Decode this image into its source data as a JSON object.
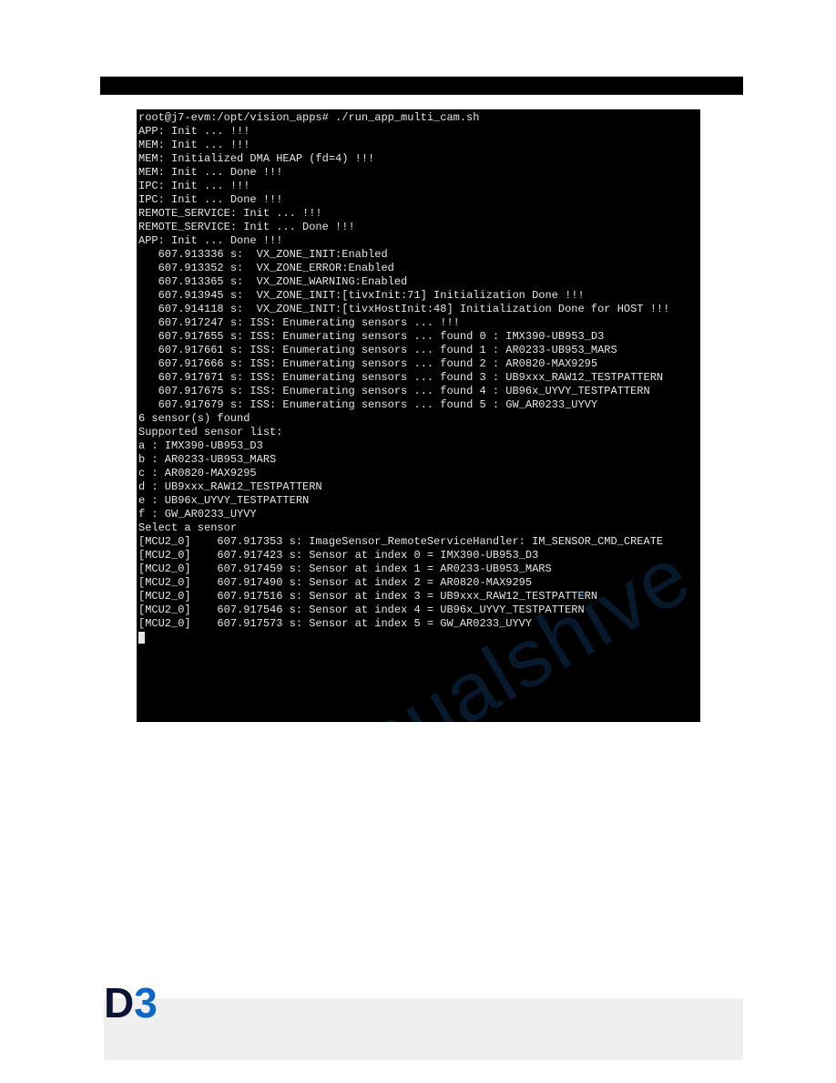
{
  "watermark_text": "manualshive.com",
  "logo": {
    "d": "D",
    "three": "3"
  },
  "terminal": {
    "lines": [
      "root@j7-evm:/opt/vision_apps# ./run_app_multi_cam.sh",
      "APP: Init ... !!!",
      "MEM: Init ... !!!",
      "MEM: Initialized DMA HEAP (fd=4) !!!",
      "MEM: Init ... Done !!!",
      "IPC: Init ... !!!",
      "IPC: Init ... Done !!!",
      "REMOTE_SERVICE: Init ... !!!",
      "REMOTE_SERVICE: Init ... Done !!!",
      "APP: Init ... Done !!!",
      "   607.913336 s:  VX_ZONE_INIT:Enabled",
      "   607.913352 s:  VX_ZONE_ERROR:Enabled",
      "   607.913365 s:  VX_ZONE_WARNING:Enabled",
      "   607.913945 s:  VX_ZONE_INIT:[tivxInit:71] Initialization Done !!!",
      "   607.914118 s:  VX_ZONE_INIT:[tivxHostInit:48] Initialization Done for HOST !!!",
      "   607.917247 s: ISS: Enumerating sensors ... !!!",
      "   607.917655 s: ISS: Enumerating sensors ... found 0 : IMX390-UB953_D3",
      "   607.917661 s: ISS: Enumerating sensors ... found 1 : AR0233-UB953_MARS",
      "   607.917666 s: ISS: Enumerating sensors ... found 2 : AR0820-MAX9295",
      "   607.917671 s: ISS: Enumerating sensors ... found 3 : UB9xxx_RAW12_TESTPATTERN",
      "   607.917675 s: ISS: Enumerating sensors ... found 4 : UB96x_UYVY_TESTPATTERN",
      "   607.917679 s: ISS: Enumerating sensors ... found 5 : GW_AR0233_UYVY",
      "6 sensor(s) found",
      "Supported sensor list:",
      "a : IMX390-UB953_D3",
      "b : AR0233-UB953_MARS",
      "c : AR0820-MAX9295",
      "d : UB9xxx_RAW12_TESTPATTERN",
      "e : UB96x_UYVY_TESTPATTERN",
      "f : GW_AR0233_UYVY",
      "Select a sensor",
      "[MCU2_0]    607.917353 s: ImageSensor_RemoteServiceHandler: IM_SENSOR_CMD_CREATE",
      "[MCU2_0]    607.917423 s: Sensor at index 0 = IMX390-UB953_D3",
      "[MCU2_0]    607.917459 s: Sensor at index 1 = AR0233-UB953_MARS",
      "[MCU2_0]    607.917490 s: Sensor at index 2 = AR0820-MAX9295",
      "[MCU2_0]    607.917516 s: Sensor at index 3 = UB9xxx_RAW12_TESTPATTERN",
      "[MCU2_0]    607.917546 s: Sensor at index 4 = UB96x_UYVY_TESTPATTERN",
      "[MCU2_0]    607.917573 s: Sensor at index 5 = GW_AR0233_UYVY"
    ]
  }
}
